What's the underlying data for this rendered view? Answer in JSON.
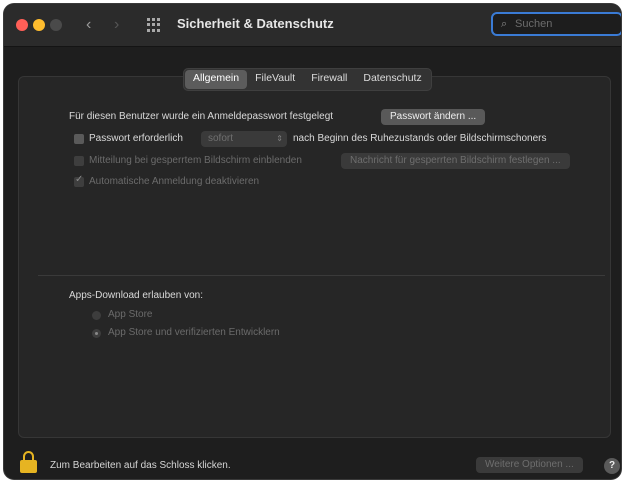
{
  "window": {
    "title": "Sicherheit & Datenschutz",
    "search_placeholder": "Suchen"
  },
  "icons": {
    "back": "‹",
    "forward": "›",
    "search": "⌕",
    "help": "?",
    "select_arrows": "⇕",
    "checkmark": "✓"
  },
  "tabs": [
    {
      "label": "Allgemein",
      "active": true
    },
    {
      "label": "FileVault",
      "active": false
    },
    {
      "label": "Firewall",
      "active": false
    },
    {
      "label": "Datenschutz",
      "active": false
    }
  ],
  "general": {
    "password_set_text": "Für diesen Benutzer wurde ein Anmeldepasswort festgelegt",
    "change_password_button": "Passwort ändern ...",
    "require_password_label": "Passwort erforderlich",
    "require_password_value": "sofort",
    "require_password_suffix": "nach Beginn des Ruhezustands oder Bildschirmschoners",
    "show_message_label": "Mitteilung bei gesperrtem Bildschirm einblenden",
    "set_message_button": "Nachricht für gesperrten Bildschirm festlegen ...",
    "disable_autologin_label": "Automatische Anmeldung deaktivieren"
  },
  "downloads": {
    "heading": "Apps-Download erlauben von:",
    "options": [
      {
        "label": "App Store",
        "selected": false
      },
      {
        "label": "App Store und verifizierten Entwicklern",
        "selected": true
      }
    ]
  },
  "footer": {
    "lock_text": "Zum Bearbeiten auf das Schloss klicken.",
    "advanced_button": "Weitere Optionen ..."
  }
}
